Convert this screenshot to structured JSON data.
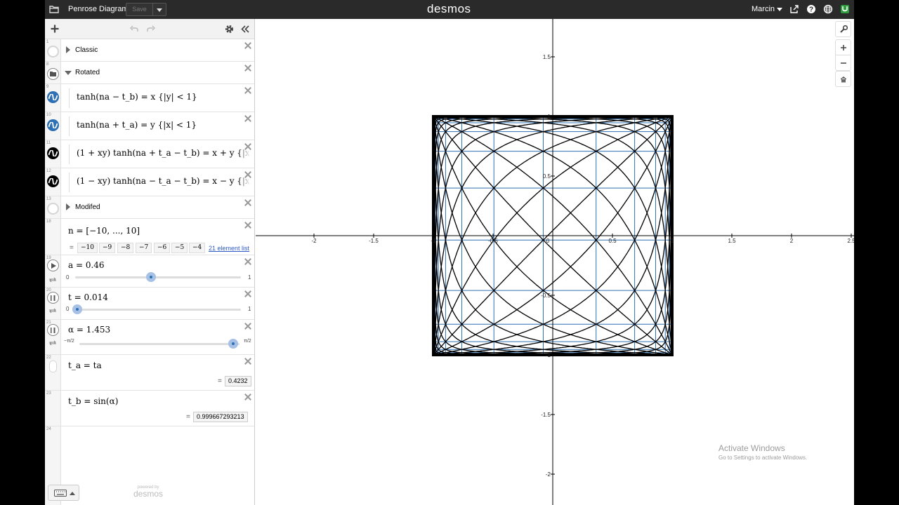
{
  "topbar": {
    "doc_title": "Penrose Diagram",
    "save_label": "Save",
    "logo": "desmos",
    "user_name": "Marcin",
    "icons": [
      "folder-icon",
      "share-icon",
      "help-icon",
      "globe-icon",
      "app-icon"
    ]
  },
  "toolbar": {
    "icons": [
      "add-icon",
      "undo-icon",
      "redo-icon",
      "settings-icon",
      "collapse-icon"
    ]
  },
  "expressions": {
    "n1": "1",
    "folder_classic": "Classic",
    "n8": "8",
    "folder_rotated": "Rotated",
    "n9": "9",
    "n10": "10",
    "n11": "11",
    "n12": "12",
    "n13": "13",
    "folder_modifed": "Modifed",
    "n18": "18",
    "n19": "19",
    "n20": "20",
    "n21": "21",
    "n22": "22",
    "n23": "23",
    "n24": "24",
    "eq9": "tanh(na − t_b) = x {|y| < 1}",
    "eq10": "tanh(na + t_a) = y {|x| < 1}",
    "eq11": "(1 + xy) tanh(na + t_a − t_b) = x + y {|xy| < 1}",
    "eq12": "(1 − xy) tanh(na − t_a − t_b) = x − y {|xy| < 1}",
    "eq18": "n = [−10, ..., 10]",
    "list_values": [
      "−10",
      "−9",
      "−8",
      "−7",
      "−6",
      "−5",
      "−4"
    ],
    "list_link": "21 element list",
    "equals": "=",
    "a_label": "a = 0.46",
    "a_min": "0",
    "a_max": "1",
    "a_value": 0.46,
    "t_label": "t = 0.014",
    "t_min": "0",
    "t_max": "1",
    "t_value": 0.014,
    "alpha_label": "α = 1.453",
    "alpha_min": "−π/2",
    "alpha_max": "π/2",
    "alpha_value": 1.453,
    "ta_label": "t_a = ta",
    "ta_value": "0.4232",
    "tb_label": "t_b = sin(α)",
    "tb_value": "0.999667293213"
  },
  "footer": {
    "keyboard_icon": "keyboard-icon",
    "powered_by": "powered by",
    "powered_logo": "desmos"
  },
  "graph": {
    "x_ticks": [
      "-2",
      "-1.5",
      "-1",
      "-0.5",
      "0",
      "0.5",
      "1",
      "1.5",
      "2",
      "2.5"
    ],
    "y_ticks": [
      "1.5",
      "1",
      "0.5",
      "-0.5",
      "-1",
      "-1.5",
      "-2"
    ],
    "buttons": [
      "wrench-icon",
      "zoom-in-icon",
      "zoom-out-icon",
      "home-icon"
    ],
    "line_color": "#000000",
    "grid_color": "#2d70b3"
  },
  "watermark": {
    "line1": "Activate Windows",
    "line2": "Go to Settings to activate Windows."
  }
}
